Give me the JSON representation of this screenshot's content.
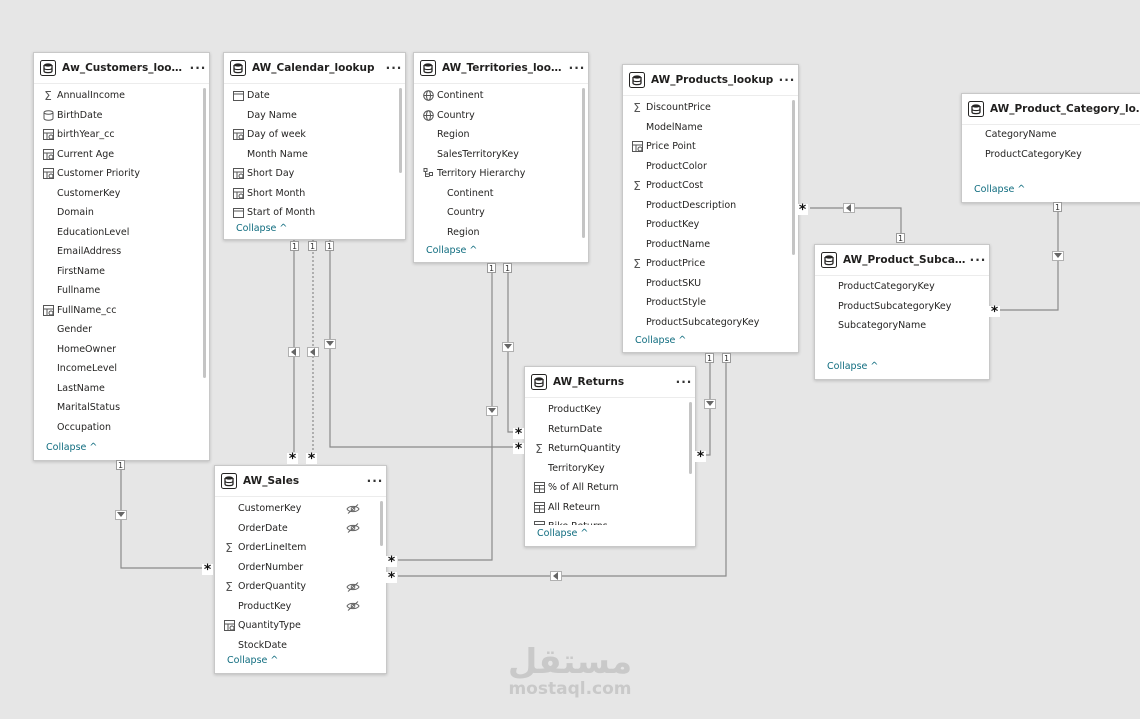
{
  "tables": {
    "customers": {
      "title": "Aw_Customers_lookup",
      "fields": [
        {
          "label": "AnnualIncome",
          "icon": "sum"
        },
        {
          "label": "BirthDate",
          "icon": "calc-table"
        },
        {
          "label": "birthYear_cc",
          "icon": "calculated"
        },
        {
          "label": "Current Age",
          "icon": "calculated"
        },
        {
          "label": "Customer Priority",
          "icon": "calculated"
        },
        {
          "label": "CustomerKey",
          "icon": "none"
        },
        {
          "label": "Domain",
          "icon": "none"
        },
        {
          "label": "EducationLevel",
          "icon": "none"
        },
        {
          "label": "EmailAddress",
          "icon": "none"
        },
        {
          "label": "FirstName",
          "icon": "none"
        },
        {
          "label": "Fullname",
          "icon": "none"
        },
        {
          "label": "FullName_cc",
          "icon": "calculated"
        },
        {
          "label": "Gender",
          "icon": "none"
        },
        {
          "label": "HomeOwner",
          "icon": "none"
        },
        {
          "label": "IncomeLevel",
          "icon": "none"
        },
        {
          "label": "LastName",
          "icon": "none"
        },
        {
          "label": "MaritalStatus",
          "icon": "none"
        },
        {
          "label": "Occupation",
          "icon": "none"
        }
      ],
      "collapse": "Collapse"
    },
    "calendar": {
      "title": "AW_Calendar_lookup",
      "fields": [
        {
          "label": "Date",
          "icon": "calendar"
        },
        {
          "label": "Day Name",
          "icon": "none"
        },
        {
          "label": "Day of week",
          "icon": "calculated"
        },
        {
          "label": "Month Name",
          "icon": "none"
        },
        {
          "label": "Short Day",
          "icon": "calculated"
        },
        {
          "label": "Short Month",
          "icon": "calculated"
        },
        {
          "label": "Start of Month",
          "icon": "calendar"
        }
      ],
      "collapse": "Collapse"
    },
    "territories": {
      "title": "AW_Territories_lookup",
      "fields": [
        {
          "label": "Continent",
          "icon": "globe"
        },
        {
          "label": "Country",
          "icon": "globe"
        },
        {
          "label": "Region",
          "icon": "none"
        },
        {
          "label": "SalesTerritoryKey",
          "icon": "none"
        },
        {
          "label": "Territory Hierarchy",
          "icon": "hierarchy"
        },
        {
          "label": "Continent",
          "icon": "none",
          "sub": true
        },
        {
          "label": "Country",
          "icon": "none",
          "sub": true
        },
        {
          "label": "Region",
          "icon": "none",
          "sub": true
        }
      ],
      "collapse": "Collapse"
    },
    "products": {
      "title": "AW_Products_lookup",
      "fields": [
        {
          "label": "DiscountPrice",
          "icon": "sum"
        },
        {
          "label": "ModelName",
          "icon": "none"
        },
        {
          "label": "Price Point",
          "icon": "calculated"
        },
        {
          "label": "ProductColor",
          "icon": "none"
        },
        {
          "label": "ProductCost",
          "icon": "sum"
        },
        {
          "label": "ProductDescription",
          "icon": "none"
        },
        {
          "label": "ProductKey",
          "icon": "none"
        },
        {
          "label": "ProductName",
          "icon": "none"
        },
        {
          "label": "ProductPrice",
          "icon": "sum"
        },
        {
          "label": "ProductSKU",
          "icon": "none"
        },
        {
          "label": "ProductStyle",
          "icon": "none"
        },
        {
          "label": "ProductSubcategoryKey",
          "icon": "none"
        }
      ],
      "collapse": "Collapse"
    },
    "category": {
      "title": "AW_Product_Category_lookup",
      "fields": [
        {
          "label": "CategoryName",
          "icon": "none"
        },
        {
          "label": "ProductCategoryKey",
          "icon": "none"
        }
      ],
      "collapse": "Collapse"
    },
    "subcategory": {
      "title": "AW_Product_Subcatego...",
      "fields": [
        {
          "label": "ProductCategoryKey",
          "icon": "none"
        },
        {
          "label": "ProductSubcategoryKey",
          "icon": "none"
        },
        {
          "label": "SubcategoryName",
          "icon": "none"
        }
      ],
      "collapse": "Collapse"
    },
    "returns": {
      "title": "AW_Returns",
      "fields": [
        {
          "label": "ProductKey",
          "icon": "none"
        },
        {
          "label": "ReturnDate",
          "icon": "none"
        },
        {
          "label": "ReturnQuantity",
          "icon": "sum"
        },
        {
          "label": "TerritoryKey",
          "icon": "none"
        },
        {
          "label": "% of All Return",
          "icon": "measure"
        },
        {
          "label": "All Reteurn",
          "icon": "measure"
        },
        {
          "label": "Bike Returns",
          "icon": "measure"
        }
      ],
      "collapse": "Collapse"
    },
    "sales": {
      "title": "AW_Sales",
      "fields": [
        {
          "label": "CustomerKey",
          "icon": "none",
          "hidden": true
        },
        {
          "label": "OrderDate",
          "icon": "none",
          "hidden": true
        },
        {
          "label": "OrderLineItem",
          "icon": "sum"
        },
        {
          "label": "OrderNumber",
          "icon": "none"
        },
        {
          "label": "OrderQuantity",
          "icon": "sum",
          "hidden": true
        },
        {
          "label": "ProductKey",
          "icon": "none",
          "hidden": true
        },
        {
          "label": "QuantityType",
          "icon": "calculated"
        },
        {
          "label": "StockDate",
          "icon": "none"
        }
      ],
      "collapse": "Collapse"
    }
  },
  "cardinality": {
    "one": "1",
    "many": "*"
  },
  "watermark": {
    "arabic": "مستقل",
    "latin": "mostaql.com"
  },
  "colors": {
    "line": "#8a8a8a",
    "link": "#0f6c7f",
    "canvas": "#e6e6e6"
  }
}
